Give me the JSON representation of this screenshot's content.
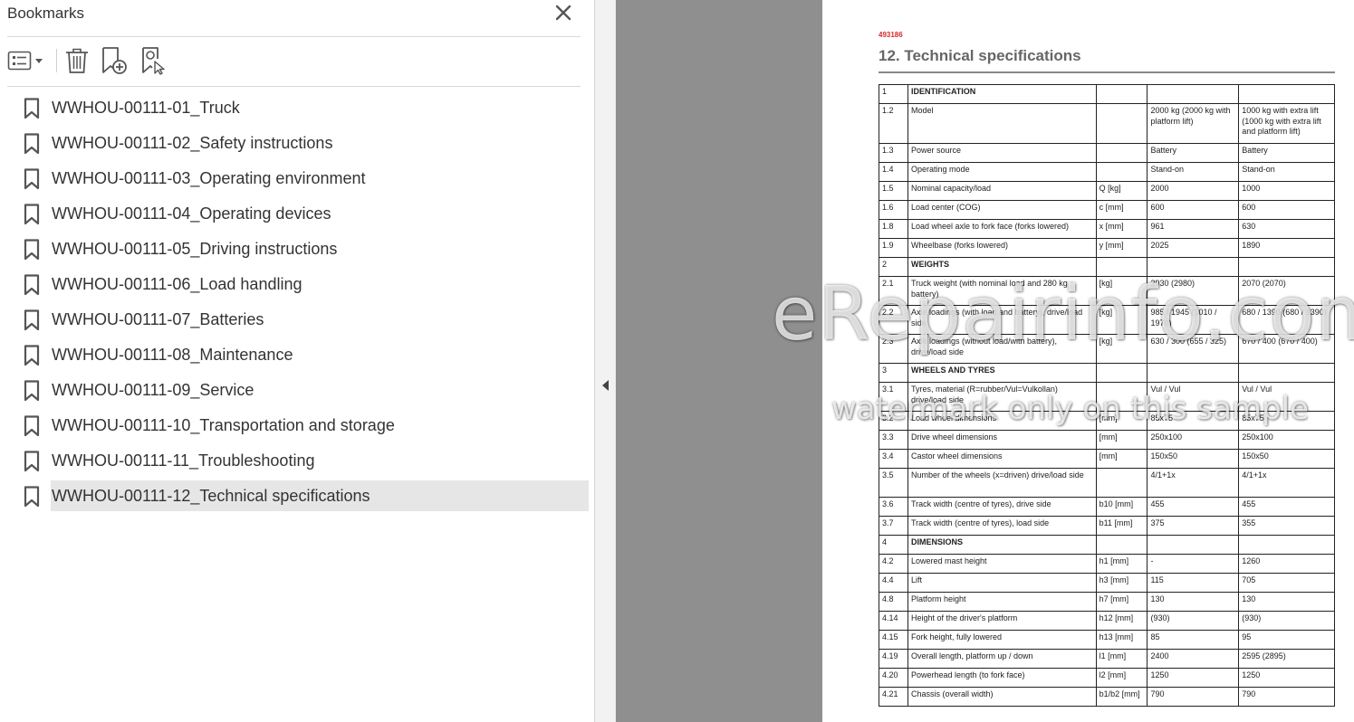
{
  "panel": {
    "title": "Bookmarks",
    "icons": {
      "close": "close-icon",
      "options": "list-options-icon",
      "delete": "trash-icon",
      "new_bookmark": "add-bookmark-icon",
      "find_bookmark": "find-bookmark-icon"
    },
    "bookmarks": [
      {
        "label": "WWHOU-00111-01_Truck",
        "selected": false
      },
      {
        "label": "WWHOU-00111-02_Safety instructions",
        "selected": false
      },
      {
        "label": "WWHOU-00111-03_Operating environment",
        "selected": false
      },
      {
        "label": "WWHOU-00111-04_Operating devices",
        "selected": false
      },
      {
        "label": "WWHOU-00111-05_Driving instructions",
        "selected": false
      },
      {
        "label": "WWHOU-00111-06_Load handling",
        "selected": false
      },
      {
        "label": "WWHOU-00111-07_Batteries",
        "selected": false
      },
      {
        "label": "WWHOU-00111-08_Maintenance",
        "selected": false
      },
      {
        "label": "WWHOU-00111-09_Service",
        "selected": false
      },
      {
        "label": "WWHOU-00111-10_Transportation and storage",
        "selected": false
      },
      {
        "label": "WWHOU-00111-11_Troubleshooting",
        "selected": false
      },
      {
        "label": "WWHOU-00111-12_Technical specifications",
        "selected": true
      }
    ]
  },
  "document": {
    "code": "493186",
    "title": "12. Technical specifications",
    "rows": [
      {
        "num": "1",
        "desc": "IDENTIFICATION",
        "unit": "",
        "v1": "",
        "v2": "",
        "section": true
      },
      {
        "num": "1.2",
        "desc": "Model",
        "unit": "",
        "v1": "2000 kg (2000 kg with platform lift)",
        "v2": "1000 kg with extra lift (1000 kg with extra lift and platform lift)",
        "size": "tall"
      },
      {
        "num": "1.3",
        "desc": "Power source",
        "unit": "",
        "v1": "Battery",
        "v2": "Battery"
      },
      {
        "num": "1.4",
        "desc": "Operating mode",
        "unit": "",
        "v1": "Stand-on",
        "v2": "Stand-on"
      },
      {
        "num": "1.5",
        "desc": "Nominal capacity/load",
        "unit": "Q [kg]",
        "v1": "2000",
        "v2": "1000"
      },
      {
        "num": "1.6",
        "desc": "Load center (COG)",
        "unit": "c [mm]",
        "v1": "600",
        "v2": "600"
      },
      {
        "num": "1.8",
        "desc": "Load wheel axle to fork face (forks lowered)",
        "unit": "x [mm]",
        "v1": "961",
        "v2": "630"
      },
      {
        "num": "1.9",
        "desc": "Wheelbase (forks lowered)",
        "unit": "y [mm]",
        "v1": "2025",
        "v2": "1890"
      },
      {
        "num": "2",
        "desc": "WEIGHTS",
        "unit": "",
        "v1": "",
        "v2": "",
        "section": true
      },
      {
        "num": "2.1",
        "desc": "Truck weight (with nominal load and 280 kg battery)",
        "unit": "[kg]",
        "v1": "2930 (2980)",
        "v2": "2070 (2070)",
        "size": "mid"
      },
      {
        "num": "2.2",
        "desc": "Axle loadings (with load and battery), drive/load side",
        "unit": "[kg]",
        "v1": "985 / 1945 (1010 / 1970)",
        "v2": "680 / 1390 (680 / 1390)",
        "size": "mid"
      },
      {
        "num": "2.3",
        "desc": "Axle loadings (without load/with battery), drive/load side",
        "unit": "[kg]",
        "v1": "630 / 300 (655 / 325)",
        "v2": "670 / 400 (670 / 400)",
        "size": "mid"
      },
      {
        "num": "3",
        "desc": "WHEELS AND TYRES",
        "unit": "",
        "v1": "",
        "v2": "",
        "section": true
      },
      {
        "num": "3.1",
        "desc": "Tyres, material (R=rubber/Vul=Vulkollan) drive/load side",
        "unit": "",
        "v1": "Vul / Vul",
        "v2": "Vul / Vul",
        "size": "mid"
      },
      {
        "num": "3.2",
        "desc": "Load wheel dimensions",
        "unit": "[mm]",
        "v1": "85x75",
        "v2": "85x75"
      },
      {
        "num": "3.3",
        "desc": "Drive wheel dimensions",
        "unit": "[mm]",
        "v1": "250x100",
        "v2": "250x100"
      },
      {
        "num": "3.4",
        "desc": "Castor wheel dimensions",
        "unit": "[mm]",
        "v1": "150x50",
        "v2": "150x50"
      },
      {
        "num": "3.5",
        "desc": "Number of the wheels (x=driven) drive/load side",
        "unit": "",
        "v1": "4/1+1x",
        "v2": "4/1+1x",
        "size": "mid"
      },
      {
        "num": "3.6",
        "desc": "Track width (centre of tyres), drive side",
        "unit": "b10 [mm]",
        "v1": "455",
        "v2": "455"
      },
      {
        "num": "3.7",
        "desc": "Track width (centre of tyres), load side",
        "unit": "b11 [mm]",
        "v1": "375",
        "v2": "355"
      },
      {
        "num": "4",
        "desc": "DIMENSIONS",
        "unit": "",
        "v1": "",
        "v2": "",
        "section": true
      },
      {
        "num": "4.2",
        "desc": "Lowered mast height",
        "unit": "h1 [mm]",
        "v1": "-",
        "v2": "1260"
      },
      {
        "num": "4.4",
        "desc": "Lift",
        "unit": "h3 [mm]",
        "v1": "115",
        "v2": "705"
      },
      {
        "num": "4.8",
        "desc": "Platform height",
        "unit": "h7 [mm]",
        "v1": "130",
        "v2": "130"
      },
      {
        "num": "4.14",
        "desc": "Height of the driver's platform",
        "unit": "h12 [mm]",
        "v1": "(930)",
        "v2": "(930)"
      },
      {
        "num": "4.15",
        "desc": "Fork height, fully lowered",
        "unit": "h13 [mm]",
        "v1": "85",
        "v2": "95"
      },
      {
        "num": "4.19",
        "desc": "Overall length, platform up / down",
        "unit": "l1 [mm]",
        "v1": "2400",
        "v2": "2595 (2895)"
      },
      {
        "num": "4.20",
        "desc": "Powerhead length (to fork face)",
        "unit": "l2 [mm]",
        "v1": "1250",
        "v2": "1250"
      },
      {
        "num": "4.21",
        "desc": "Chassis (overall width)",
        "unit": "b1/b2 [mm]",
        "v1": "790",
        "v2": "790"
      }
    ]
  },
  "watermark": {
    "line1": "eRepairinfo.com",
    "line2": "watermark only on this sample"
  },
  "colors": {
    "selected_bg": "#e6e6e6",
    "gutter": "#8f8f8f",
    "doc_code": "#d62b2b"
  }
}
